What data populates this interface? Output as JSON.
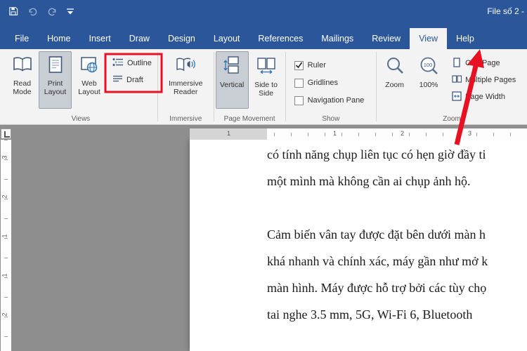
{
  "colors": {
    "title_bar": "#2b579a",
    "accent": "#2b579a",
    "annotation": "#e81123",
    "selected_button_bg": "#c9cdd4",
    "doc_background": "#8e8e8e"
  },
  "title_bar": {
    "title": "File số 2  -"
  },
  "tabs": [
    {
      "label": "File",
      "active": false
    },
    {
      "label": "Home",
      "active": false
    },
    {
      "label": "Insert",
      "active": false
    },
    {
      "label": "Draw",
      "active": false
    },
    {
      "label": "Design",
      "active": false
    },
    {
      "label": "Layout",
      "active": false
    },
    {
      "label": "References",
      "active": false
    },
    {
      "label": "Mailings",
      "active": false
    },
    {
      "label": "Review",
      "active": false
    },
    {
      "label": "View",
      "active": true
    },
    {
      "label": "Help",
      "active": false
    }
  ],
  "ribbon": {
    "views_group": {
      "label": "Views",
      "read_mode": "Read Mode",
      "print_layout": "Print Layout",
      "web_layout": "Web Layout",
      "outline": "Outline",
      "draft": "Draft",
      "selected": "Print Layout"
    },
    "immersive_group": {
      "label": "Immersive",
      "immersive_reader": "Immersive Reader"
    },
    "page_movement_group": {
      "label": "Page Movement",
      "vertical": "Vertical",
      "side_to_side": "Side to Side",
      "selected": "Vertical"
    },
    "show_group": {
      "label": "Show",
      "ruler": {
        "label": "Ruler",
        "checked": true
      },
      "gridlines": {
        "label": "Gridlines",
        "checked": false
      },
      "navigation_pane": {
        "label": "Navigation Pane",
        "checked": false
      }
    },
    "zoom_group": {
      "label": "Zoom",
      "zoom": "Zoom",
      "hundred": "100%",
      "one_page": "One Page",
      "multiple_pages": "Multiple Pages",
      "page_width": "Page Width"
    }
  },
  "ruler": {
    "horizontal_numbers": [
      "1",
      "1",
      "2",
      "3"
    ],
    "vertical_numbers": [
      "3",
      "2",
      "1",
      "1",
      "2"
    ]
  },
  "document": {
    "lines": [
      "có tính năng chụp liên tục có hẹn giờ đầy ti",
      "một mình mà không cần ai chụp ảnh hộ.",
      "",
      "Cảm biến vân tay được đặt bên dưới màn h",
      "khá nhanh và chính xác, máy gần như mở k",
      "màn hình. Máy được hỗ trợ bởi các tùy chọ",
      "tai nghe 3.5 mm, 5G, Wi-Fi 6, Bluetooth"
    ]
  }
}
